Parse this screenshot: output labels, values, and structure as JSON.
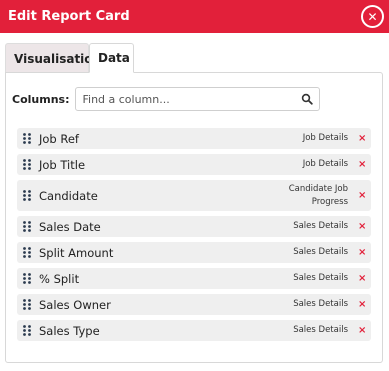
{
  "header": {
    "title": "Edit Report Card",
    "close_symbol": "✕"
  },
  "tabs": [
    {
      "label": "Visualisation",
      "active": false
    },
    {
      "label": "Data",
      "active": true
    }
  ],
  "columns": {
    "label": "Columns:",
    "search_placeholder": "Find a column...",
    "items": [
      {
        "label": "Job Ref",
        "group": "Job Details"
      },
      {
        "label": "Job Title",
        "group": "Job Details"
      },
      {
        "label": "Candidate",
        "group": "Candidate Job Progress"
      },
      {
        "label": "Sales Date",
        "group": "Sales Details"
      },
      {
        "label": "Split Amount",
        "group": "Sales Details"
      },
      {
        "label": "% Split",
        "group": "Sales Details"
      },
      {
        "label": "Sales Owner",
        "group": "Sales Details"
      },
      {
        "label": "Sales Type",
        "group": "Sales Details"
      }
    ],
    "remove_symbol": "×"
  },
  "colors": {
    "accent": "#e2203a",
    "row_bg": "#efefef",
    "handle": "#2b3a4e"
  }
}
